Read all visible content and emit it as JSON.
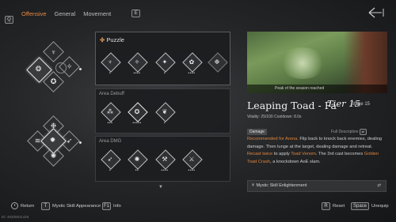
{
  "topbar": {
    "q_key": "Q",
    "tabs": [
      "Offensive",
      "General",
      "Movement"
    ],
    "e_key": "E"
  },
  "puzzle": {
    "title": "Puzzle",
    "skills": [
      {
        "icon": "antler-icon",
        "glyph": "♆",
        "dots": "•"
      },
      {
        "icon": "claw-icon",
        "glyph": "✧",
        "dots": "••••"
      },
      {
        "icon": "slash-icon",
        "glyph": "✦",
        "dots": "•"
      },
      {
        "icon": "spiral-icon",
        "glyph": "✿",
        "dots": "••••"
      },
      {
        "icon": "burst-icon",
        "glyph": "❉",
        "dots": ""
      }
    ]
  },
  "area_debuff": {
    "title": "Area Debuff",
    "skills": [
      {
        "icon": "shards-icon",
        "glyph": "⁂",
        "dots": "•••"
      },
      {
        "icon": "swirl-icon",
        "glyph": "✪",
        "dots": "•••••"
      },
      {
        "icon": "wings-icon",
        "glyph": "❦",
        "dots": "•"
      }
    ]
  },
  "area_dmg": {
    "title": "Area DMG",
    "skills": [
      {
        "icon": "spear-icon",
        "glyph": "➶",
        "dots": "•"
      },
      {
        "icon": "whirl-icon",
        "glyph": "✺",
        "dots": "••"
      },
      {
        "icon": "claws-icon",
        "glyph": "⚒",
        "dots": "••••"
      },
      {
        "icon": "blade-icon",
        "glyph": "⚔",
        "dots": "••••"
      }
    ]
  },
  "preview": {
    "caption": "Peak of the season reached"
  },
  "detail": {
    "name": "Leaping Toad - Fa",
    "tier": "Tier 15",
    "stage": "Stage 15",
    "stats": "Vitality: 25/100    Cooldown: 8.0s",
    "tag": "Damage",
    "full_desc": "Full Description",
    "desc_rec": "Recommended for Arena.",
    "desc_1": " Flip back to knock back enemies, dealing damage. Then lunge at the target, dealing damage and retreat. ",
    "desc_recast": "Recast twice",
    "desc_2": " to apply ",
    "desc_venom": "Toad Venom",
    "desc_3": ". The 3rd cast becomes ",
    "desc_crash": "Golden Toad Crash",
    "desc_4": ", a knockdown AoE slam."
  },
  "enlightenment": {
    "label": "Mystic Skill Enlightenment"
  },
  "bottom": {
    "return_label": "Return",
    "appearance_key": "T",
    "appearance_label": "Mystic Skill Appearance",
    "info_key": "F1",
    "info_label": "Info",
    "reset_key": "R",
    "reset_label": "Reset",
    "unequip_key": "Space",
    "unequip_label": "Unequip"
  },
  "version": "ID: 46200811426"
}
